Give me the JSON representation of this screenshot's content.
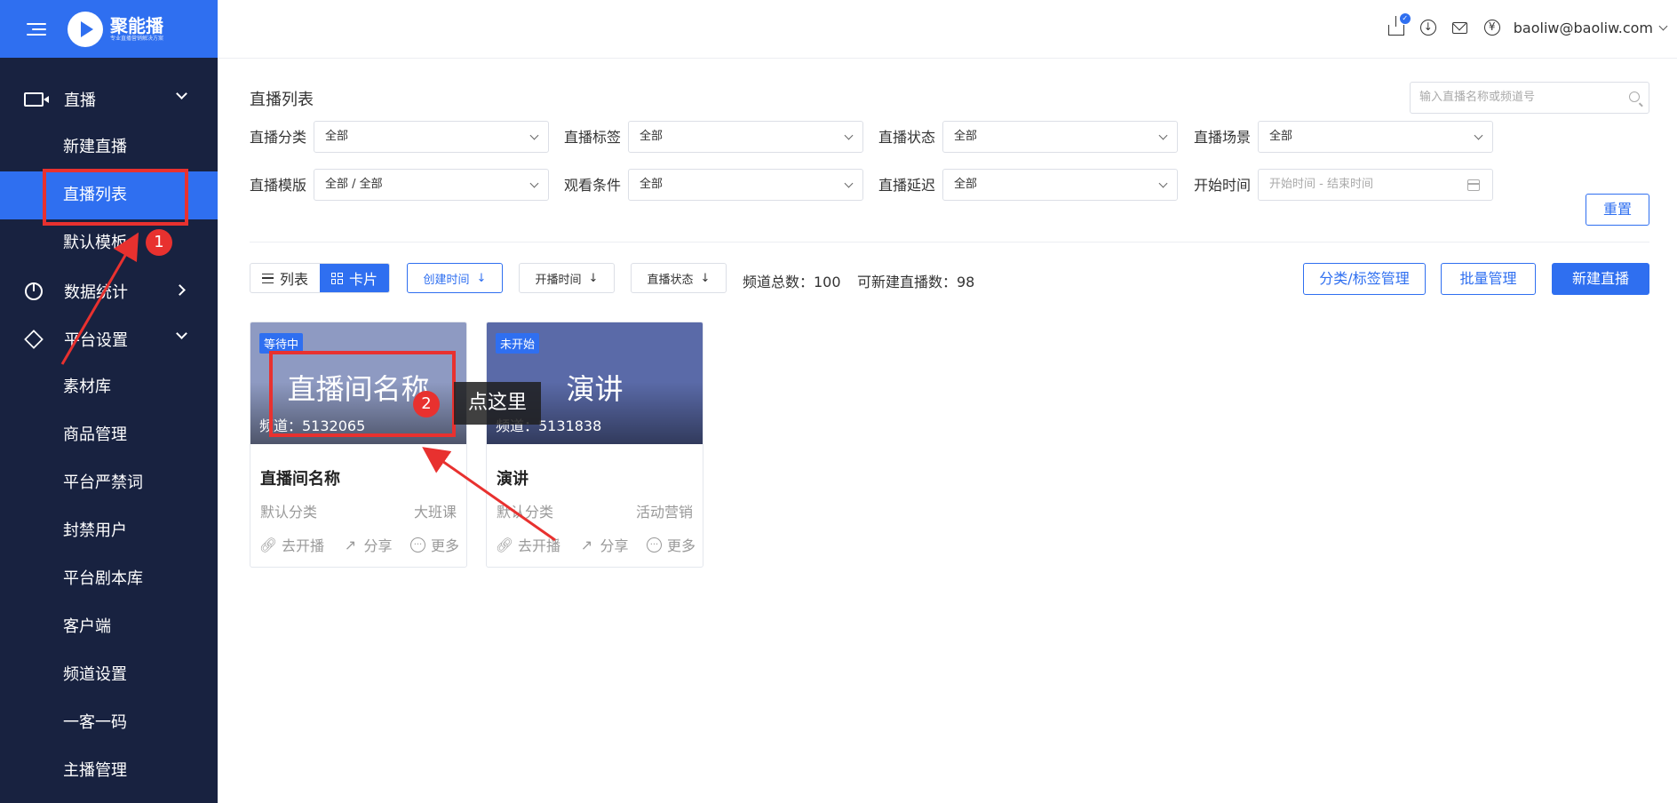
{
  "sidebar": {
    "logo_name": "聚能播",
    "logo_sub": "专业直播营销解决方案",
    "groups": [
      {
        "label": "直播",
        "icon": "video-camera-icon"
      },
      {
        "label": "数据统计",
        "icon": "pie-chart-icon"
      },
      {
        "label": "平台设置",
        "icon": "layers-icon"
      }
    ],
    "live_items": [
      "新建直播",
      "直播列表",
      "默认模板"
    ],
    "settings_items": [
      "素材库",
      "商品管理",
      "平台严禁词",
      "封禁用户",
      "平台剧本库",
      "客户端",
      "频道设置",
      "一客一码",
      "主播管理"
    ]
  },
  "header": {
    "user_email": "baoliw@baoliw.com",
    "upload_badge": "✓"
  },
  "main": {
    "title": "直播列表",
    "search_placeholder": "输入直播名称或频道号",
    "filters": [
      {
        "label": "直播分类",
        "value": "全部"
      },
      {
        "label": "直播标签",
        "value": "全部"
      },
      {
        "label": "直播状态",
        "value": "全部"
      },
      {
        "label": "直播场景",
        "value": "全部"
      },
      {
        "label": "直播模版",
        "value": "全部 / 全部"
      },
      {
        "label": "观看条件",
        "value": "全部"
      },
      {
        "label": "直播延迟",
        "value": "全部"
      },
      {
        "label": "开始时间",
        "value": "开始时间 - 结束时间"
      }
    ],
    "reset_label": "重置",
    "view_list": "列表",
    "view_card": "卡片",
    "sort": [
      {
        "label": "创建时间",
        "arrow": "↓"
      },
      {
        "label": "开播时间",
        "arrow": "↓"
      },
      {
        "label": "直播状态",
        "arrow": "↓"
      }
    ],
    "stat_total": "频道总数：100",
    "stat_available": "可新建直播数：98",
    "btn_category": "分类/标签管理",
    "btn_batch": "批量管理",
    "btn_new": "新建直播"
  },
  "cards": [
    {
      "status": "等待中",
      "cover_title": "直播间名称",
      "channel": "频道：5132065",
      "name": "直播间名称",
      "category": "默认分类",
      "tag": "大班课",
      "cover_color": "#8e9ac2"
    },
    {
      "status": "未开始",
      "cover_title": "演讲",
      "channel": "频道：5131838",
      "name": "演讲",
      "category": "默认分类",
      "tag": "活动营销",
      "cover_color": "#5a6aa8"
    }
  ],
  "card_actions": [
    "去开播",
    "分享",
    "更多"
  ],
  "annotations": {
    "badge1": "1",
    "badge2": "2",
    "tooltip": "点这里",
    "highlight_color": "#e8312f"
  }
}
